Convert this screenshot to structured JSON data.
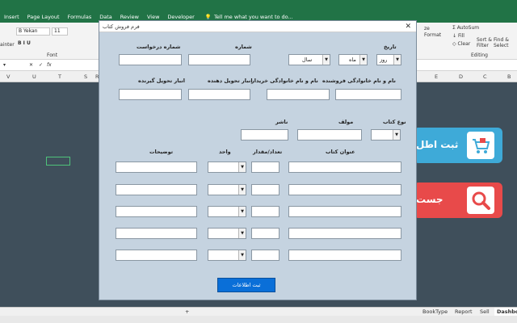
{
  "excel": {
    "tabs": [
      "Insert",
      "Page Layout",
      "Formulas",
      "Data",
      "Review",
      "View",
      "Developer"
    ],
    "tell_me": "Tell me what you want to do...",
    "ribbon": {
      "font_name": "B Yekan",
      "font_size": "11",
      "painter": "ainter",
      "font_group": "Font",
      "autosum": "AutoSum",
      "fill": "Fill",
      "clear": "Clear",
      "sort_filter": "Sort &",
      "sort_filter_2": "Filter",
      "find_select": "Find &",
      "find_select_2": "Select",
      "editing_group": "Editing",
      "format": "Format",
      "number_format": "ze"
    },
    "columns": [
      "V",
      "U",
      "T",
      "S",
      "R",
      "E",
      "D",
      "C",
      "B"
    ],
    "sheet_tabs": [
      "BookType",
      "Report",
      "Sell",
      "Dashboa"
    ]
  },
  "side_buttons": {
    "register_label": "ثبت اطل",
    "search_label": "جست"
  },
  "dialog": {
    "title": "فرم فروش کتاب",
    "close": "✕",
    "labels": {
      "date": "تاریخ",
      "number": "شماره",
      "request_number": "شماره درخواست",
      "seller": "نام و نام خانوادگی فروشنده",
      "buyer": "نام و نام خانوادگی خریدار",
      "warehouse_deliver": "انبار تحویل دهنده",
      "warehouse_receive": "انبار تحویل گیرنده",
      "book_type": "نوع کتاب",
      "author": "مولف",
      "publisher": "ناشر",
      "book_title": "عنوان کتاب",
      "quantity": "تعداد/مقدار",
      "unit": "واحد",
      "description": "توضیحات"
    },
    "date": {
      "day": "روز",
      "month": "ماه",
      "year": "سال"
    },
    "submit": "ثبت اطلاعات"
  }
}
